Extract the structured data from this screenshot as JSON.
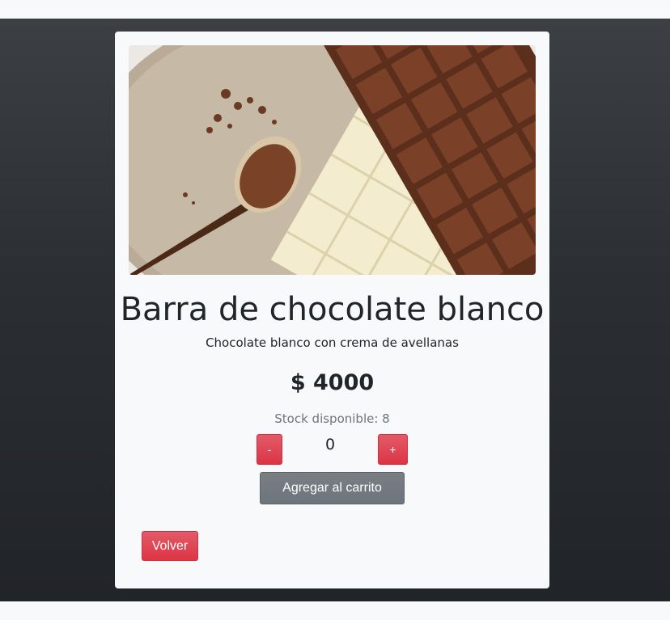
{
  "product": {
    "image_alt": "chocolate bars with cocoa spoon",
    "title": "Barra de chocolate blanco",
    "description": "Chocolate blanco con crema de avellanas",
    "price": "$ 4000",
    "stock": "Stock disponible: 8"
  },
  "quantity": {
    "minus_label": "-",
    "value": "0",
    "plus_label": "+"
  },
  "actions": {
    "add_to_cart_label": "Agregar al carrito",
    "back_label": "Volver"
  },
  "colors": {
    "danger": "#dc3545",
    "secondary": "#6c757d",
    "background_dark": "#2b2e33",
    "card": "#f8f9fa"
  }
}
